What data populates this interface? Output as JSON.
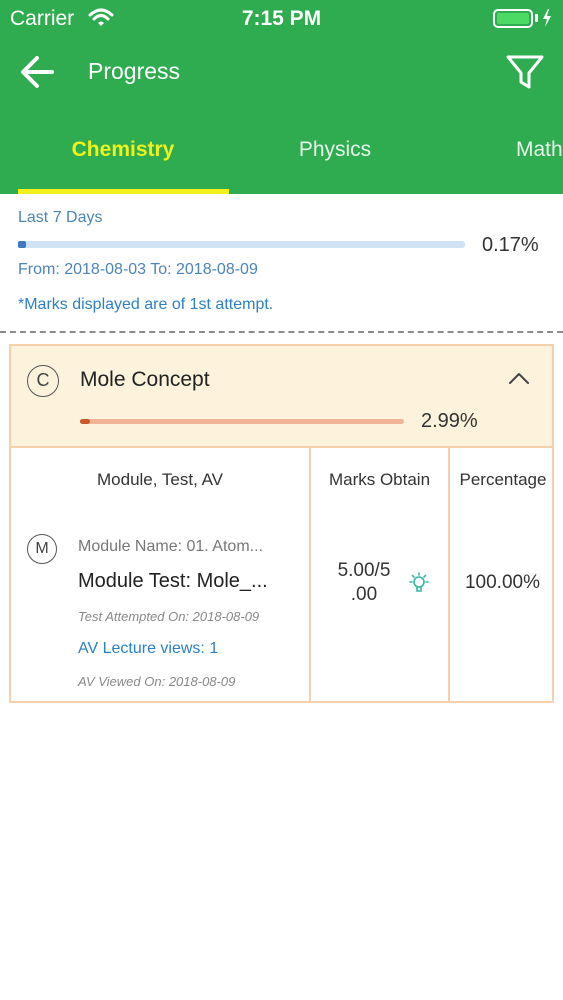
{
  "status_bar": {
    "carrier": "Carrier",
    "time": "7:15 PM"
  },
  "header": {
    "title": "Progress",
    "back_icon": "arrow-left-icon",
    "filter_icon": "filter-funnel-icon"
  },
  "tabs": [
    {
      "label": "Chemistry",
      "selected": true
    },
    {
      "label": "Physics",
      "selected": false
    },
    {
      "label": "Math",
      "selected": false
    }
  ],
  "summary": {
    "period": "Last 7 Days",
    "overall_percent": "0.17%",
    "overall_fraction": 0.017,
    "date_range": "From: 2018-08-03 To: 2018-08-09",
    "note": "*Marks displayed are of 1st attempt."
  },
  "chapter": {
    "badge": "C",
    "name": "Mole Concept",
    "percent": "2.99%",
    "fraction": 0.0299,
    "expanded": true
  },
  "table": {
    "headers": {
      "module": "Module, Test, AV",
      "marks": "Marks Obtain",
      "percentage": "Percentage"
    },
    "rows": [
      {
        "badge": "M",
        "module_name": "Module Name: 01. Atom...",
        "module_test": "Module Test: Mole_...",
        "test_attempted": "Test Attempted On: 2018-08-09",
        "av_views": "AV Lecture views: 1",
        "av_viewed": "AV Viewed On: 2018-08-09",
        "marks_line1": "5.00/5",
        "marks_line2": ".00",
        "percentage": "100.00%"
      }
    ]
  },
  "colors": {
    "header_green": "#2fac50",
    "active_tab": "#ecf21a",
    "link_blue": "#2d80c6",
    "chapter_bg": "#fdf3dc",
    "chapter_bar": "#c8582a"
  }
}
